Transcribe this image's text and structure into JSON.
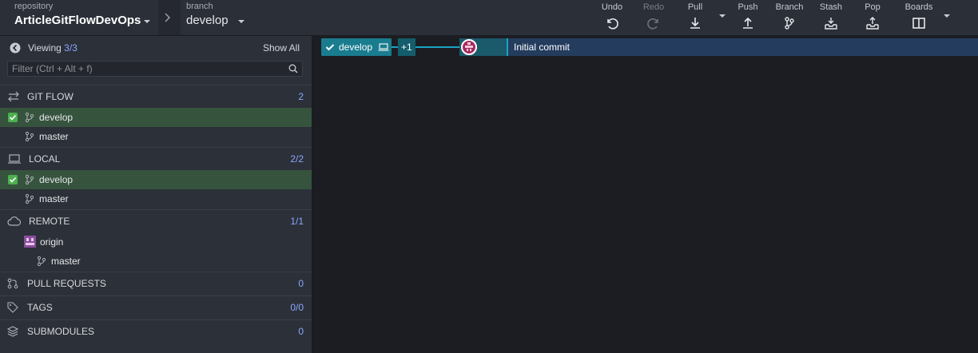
{
  "toolbar": {
    "repo_label": "repository",
    "repo_name": "ArticleGitFlowDevOps",
    "branch_label": "branch",
    "branch_name": "develop",
    "buttons": {
      "undo": "Undo",
      "redo": "Redo",
      "pull": "Pull",
      "push": "Push",
      "branch": "Branch",
      "stash": "Stash",
      "pop": "Pop",
      "boards": "Boards"
    }
  },
  "sidebar": {
    "viewing_label": "Viewing",
    "viewing_count": "3/3",
    "show_all": "Show All",
    "filter_placeholder": "Filter (Ctrl + Alt + f)",
    "gitflow": {
      "title": "GIT FLOW",
      "count": "2",
      "items": [
        "develop",
        "master"
      ]
    },
    "local": {
      "title": "LOCAL",
      "count": "2/2",
      "items": [
        "develop",
        "master"
      ]
    },
    "remote": {
      "title": "REMOTE",
      "count": "1/1",
      "remote_name": "origin",
      "items": [
        "master"
      ]
    },
    "pull_requests": {
      "title": "PULL REQUESTS",
      "count": "0"
    },
    "tags": {
      "title": "TAGS",
      "count": "0/0"
    },
    "submodules": {
      "title": "SUBMODULES",
      "count": "0"
    }
  },
  "graph": {
    "ref_name": "develop",
    "ahead_badge": "+1",
    "commit_message": "Initial commit"
  },
  "colors": {
    "accent": "#1a7c8f",
    "active_row": "#36533e",
    "checkbox": "#4caf50",
    "count": "#8aa6ff",
    "commit_row": "#243d5e",
    "node": "#a52a5e"
  }
}
